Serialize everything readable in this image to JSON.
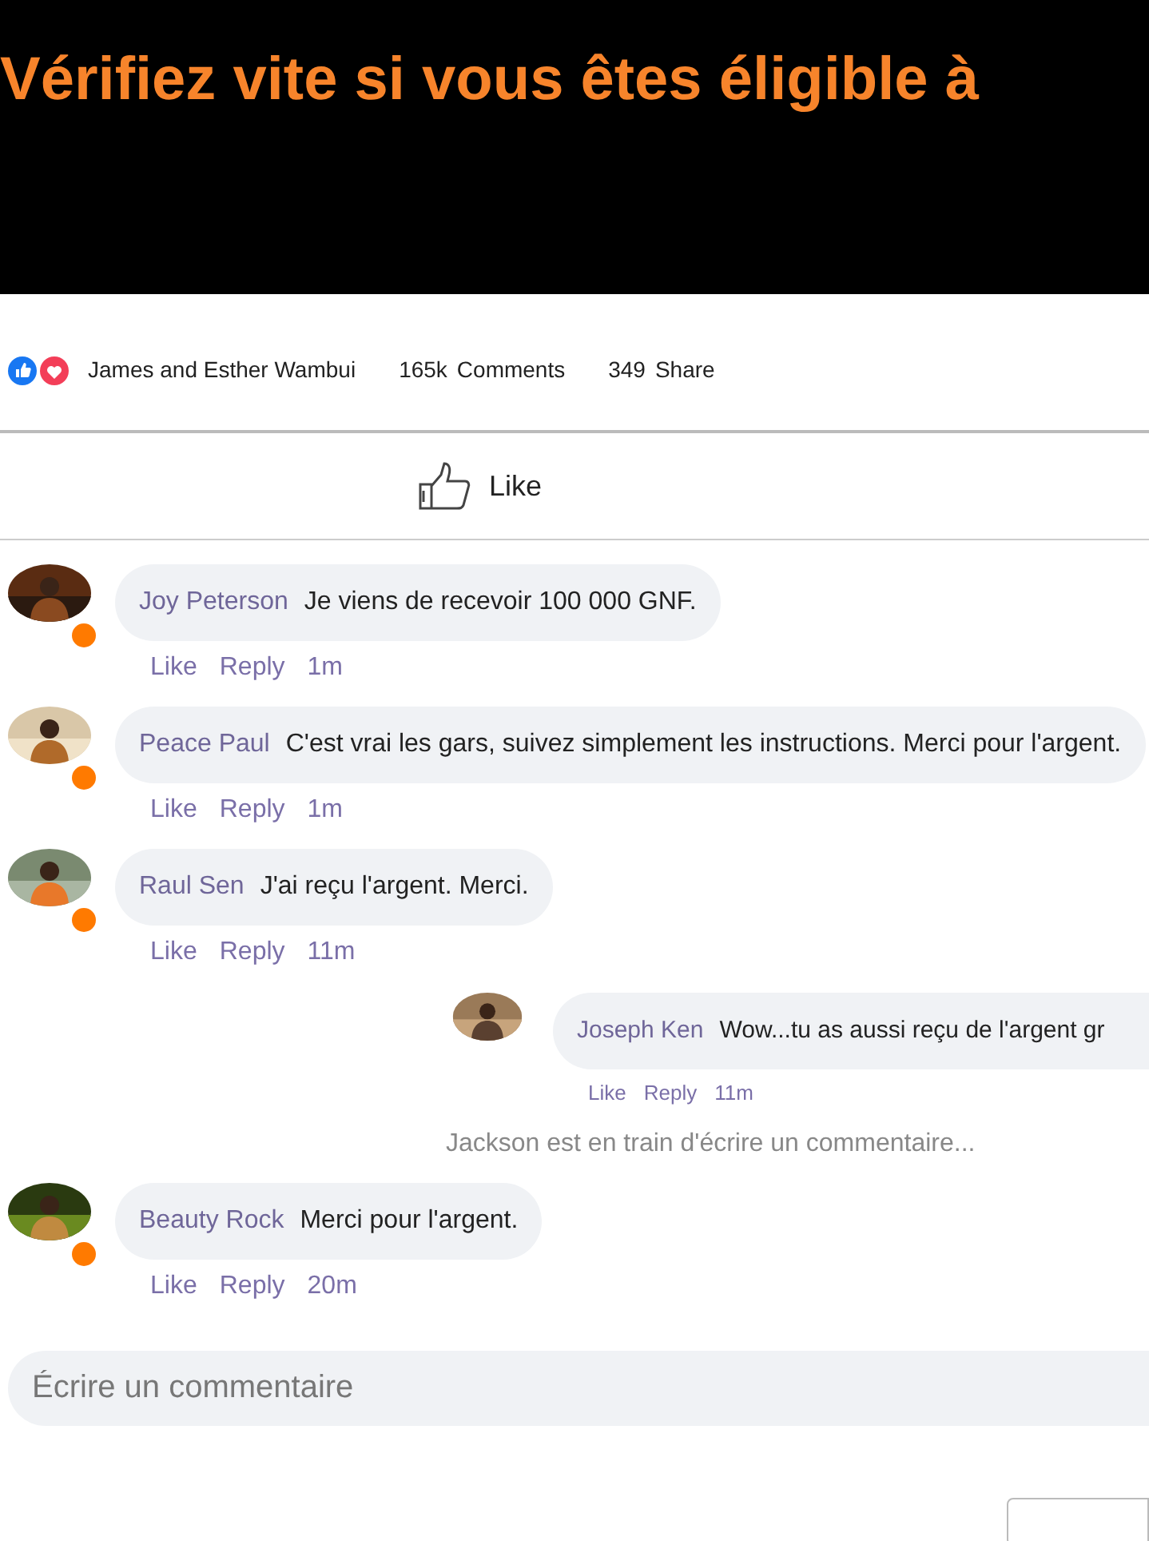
{
  "banner": {
    "headline": "Vérifiez vite si vous êtes éligible à"
  },
  "reactions": {
    "names": "James and Esther Wambui",
    "comments_count": "165k",
    "comments_label": "Comments",
    "shares_count": "349",
    "shares_label": "Share"
  },
  "like_button": {
    "label": "Like"
  },
  "comments": [
    {
      "author": "Joy Peterson",
      "text": "Je viens de recevoir 100 000 GNF.",
      "online": true,
      "kind": "comment",
      "actions": [
        "Like",
        "Reply"
      ],
      "time": "1m"
    },
    {
      "author": "Peace Paul",
      "text": "C'est vrai les gars, suivez simplement les instructions. Merci pour l'argent.",
      "online": true,
      "kind": "comment",
      "actions": [
        "Like",
        "Reply"
      ],
      "time": "1m"
    },
    {
      "author": "Raul Sen",
      "text": "J'ai reçu l'argent. Merci.",
      "online": true,
      "kind": "comment",
      "actions": [
        "Like",
        "Reply"
      ],
      "time": "11m"
    },
    {
      "author": "Joseph Ken",
      "text": "Wow...tu as aussi reçu de l'argent gr",
      "online": false,
      "kind": "reply",
      "actions": [
        "Like",
        "Reply"
      ],
      "time": "11m"
    },
    {
      "kind": "typing",
      "text": "Jackson est en train d'écrire un commentaire..."
    },
    {
      "author": "Beauty Rock",
      "text": "Merci pour l'argent.",
      "online": true,
      "kind": "comment",
      "actions": [
        "Like",
        "Reply"
      ],
      "time": "20m"
    }
  ],
  "comment_field": {
    "placeholder": "Écrire un commentaire"
  }
}
